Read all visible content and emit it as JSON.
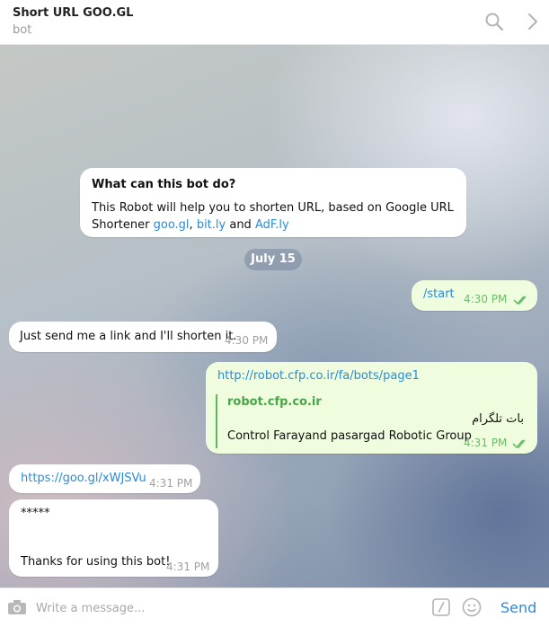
{
  "header": {
    "title": "Short URL GOO.GL",
    "subtitle": "bot",
    "icons": [
      "search-icon",
      "chevron-right-icon"
    ]
  },
  "chat": {
    "info_card": {
      "heading": "What can this bot do?",
      "body_prefix": "This Robot will help you to shorten URL, based on Google URL",
      "body_line2_prefix": "Shortener ",
      "link1": "goo.gl",
      "sep1": ", ",
      "link2": "bit.ly",
      "sep2": " and ",
      "link3": "AdF.ly"
    },
    "date_separator": "July 15",
    "messages": [
      {
        "direction": "out",
        "text": "/start",
        "time": "4:30 PM",
        "status": "read"
      },
      {
        "direction": "in",
        "text": "Just send me a link and I'll shorten it.",
        "time": "4:30 PM"
      },
      {
        "direction": "out",
        "text": "http://robot.cfp.co.ir/fa/bots/page1",
        "time": "4:31 PM",
        "status": "read",
        "preview": {
          "site": "robot.cfp.co.ir",
          "title": "بات تلگرام",
          "description": "Control Farayand pasargad Robotic Group"
        }
      },
      {
        "direction": "in",
        "text": "https://goo.gl/xWJSVu",
        "time": "4:31 PM"
      },
      {
        "direction": "in",
        "line1": "*****",
        "line2": "Thanks for using this bot!",
        "time": "4:31 PM"
      }
    ]
  },
  "input_bar": {
    "placeholder": "Write a message...",
    "send_label": "Send",
    "icons": [
      "camera-icon",
      "commands-icon",
      "emoji-icon"
    ]
  },
  "colors": {
    "accent": "#2b8ad8",
    "outgoing_bubble": "#effdde",
    "read_ticks": "#6dbb6a",
    "preview_site": "#4aa54a"
  }
}
